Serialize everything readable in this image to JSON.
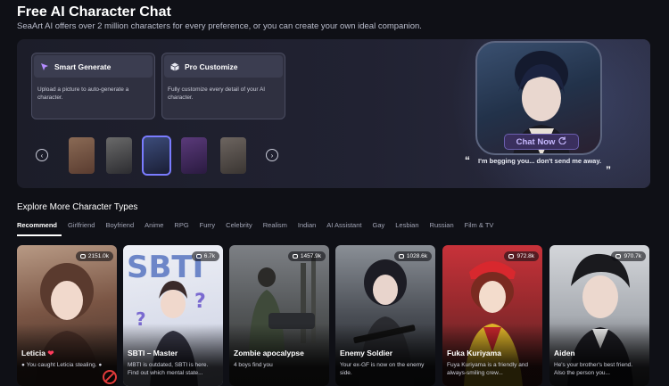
{
  "header": {
    "title": "Free AI Character Chat",
    "subtitle": "SeaArt AI offers over 2 million characters for every preference, or you can create your own ideal companion."
  },
  "hero": {
    "features": [
      {
        "icon": "cursor-icon",
        "label": "Smart Generate",
        "desc": "Upload a picture to auto-generate a character."
      },
      {
        "icon": "cube-icon",
        "label": "Pro Customize",
        "desc": "Fully customize every detail of your AI character."
      }
    ],
    "chat_now_label": "Chat Now",
    "quote": "I'm begging you... don't send me away."
  },
  "explore": {
    "title": "Explore More Character Types",
    "tabs": [
      "Recommend",
      "Girlfriend",
      "Boyfriend",
      "Anime",
      "RPG",
      "Furry",
      "Celebrity",
      "Realism",
      "Indian",
      "AI Assistant",
      "Gay",
      "Lesbian",
      "Russian",
      "Film & TV"
    ],
    "active_tab": "Recommend"
  },
  "cards": [
    {
      "name": "Leticia",
      "count": "2151.0k",
      "blurb": "You caught Leticia stealing."
    },
    {
      "name": "SBTI – Master",
      "count": "6.7k",
      "blurb": "MBTI is outdated, SBTI is here. Find out which mental state..."
    },
    {
      "name": "Zombie apocalypse",
      "count": "1457.9k",
      "blurb": "4 boys find you"
    },
    {
      "name": "Enemy Soldier",
      "count": "1028.6k",
      "blurb": "Your ex-GF is now on the enemy side."
    },
    {
      "name": "Fuka Kuriyama",
      "count": "972.8k",
      "blurb": "Fuya Kuriyama is a friendly and always-smiling crew..."
    },
    {
      "name": "Aiden",
      "count": "970.7k",
      "blurb": "He's your brother's best friend. Also the person you..."
    }
  ],
  "colors": {
    "accent": "#7a7cff",
    "chat_now_text": "#c7b9ff",
    "heart": "#ff3b5c"
  }
}
